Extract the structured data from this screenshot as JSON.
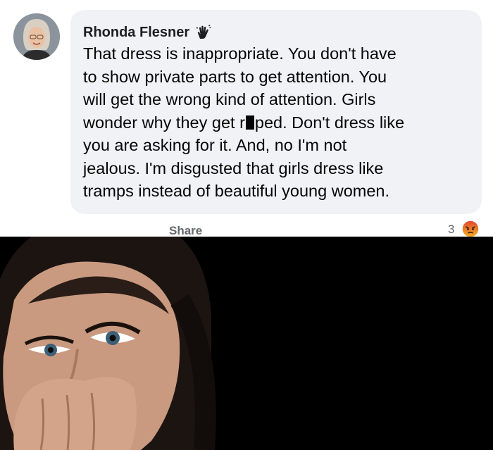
{
  "comment": {
    "author": "Rhonda Flesner",
    "badge_icon": "wave-hand-icon",
    "text_before_redaction": "That dress is inappropriate. You don't have\nto show private parts to get attention. You\nwill get the wrong kind of attention. Girls\nwonder why they get r",
    "text_after_redaction": "ped. Don't dress like\nyou are asking for it. And, no I'm not\njealous. I'm disgusted that girls dress like\ntramps instead of beautiful young women.",
    "share_label": "Share",
    "reaction_count": "3",
    "reaction_icon": "angry-face-icon"
  },
  "colors": {
    "bubble": "#f0f2f5",
    "text": "#050505",
    "meta": "#65676b",
    "photo_background": "#000000"
  }
}
